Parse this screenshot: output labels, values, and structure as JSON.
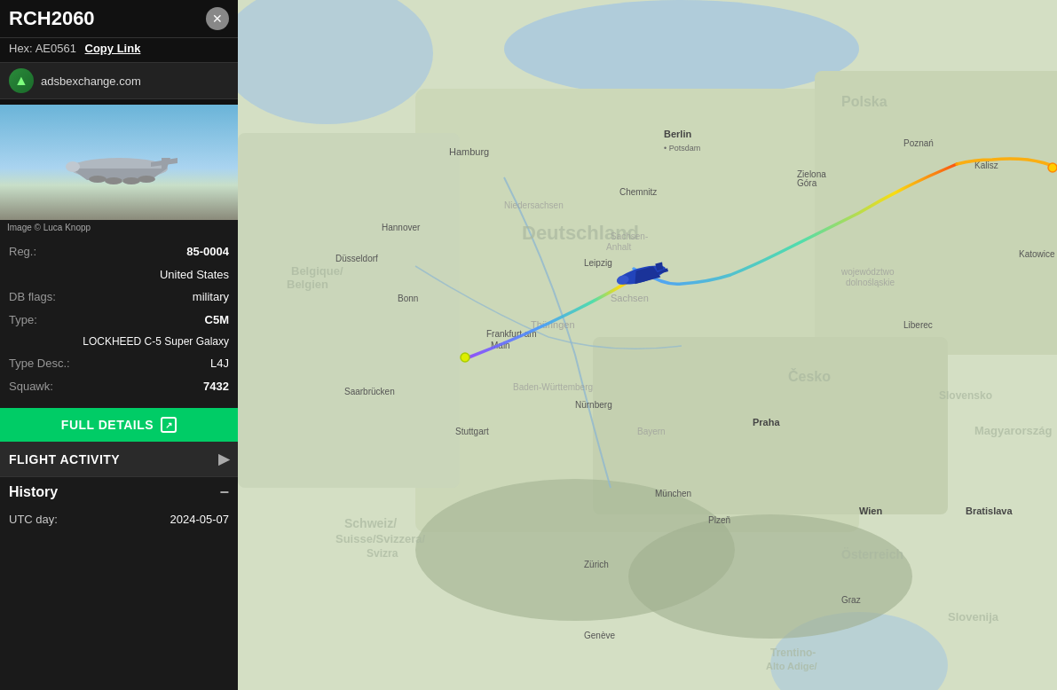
{
  "sidebar": {
    "title": "RCH2060",
    "close_label": "✕",
    "hex_label": "Hex:",
    "hex_value": "AE0561",
    "copy_link_label": "Copy Link",
    "source_name": "adsbexchange.com",
    "source_icon": "▲",
    "image_credit": "Image © Luca Knopp",
    "fields": [
      {
        "label": "Reg.:",
        "value": "85-0004"
      },
      {
        "label": "",
        "value": "United States"
      },
      {
        "label": "DB flags:",
        "value": "military"
      },
      {
        "label": "Type:",
        "value": "C5M"
      },
      {
        "label": "",
        "value": "LOCKHEED C-5 Super Galaxy"
      },
      {
        "label": "Type Desc.:",
        "value": "L4J"
      },
      {
        "label": "Squawk:",
        "value": "7432"
      }
    ],
    "full_details_label": "FULL DETAILS",
    "flight_activity_label": "FLIGHT ACTIVITY",
    "history_label": "History",
    "utc_day_label": "UTC day:",
    "utc_date_value": "2024-05-07"
  },
  "colors": {
    "accent_green": "#00cc66",
    "sidebar_bg": "#1a1a1a",
    "header_bg": "#111111"
  }
}
